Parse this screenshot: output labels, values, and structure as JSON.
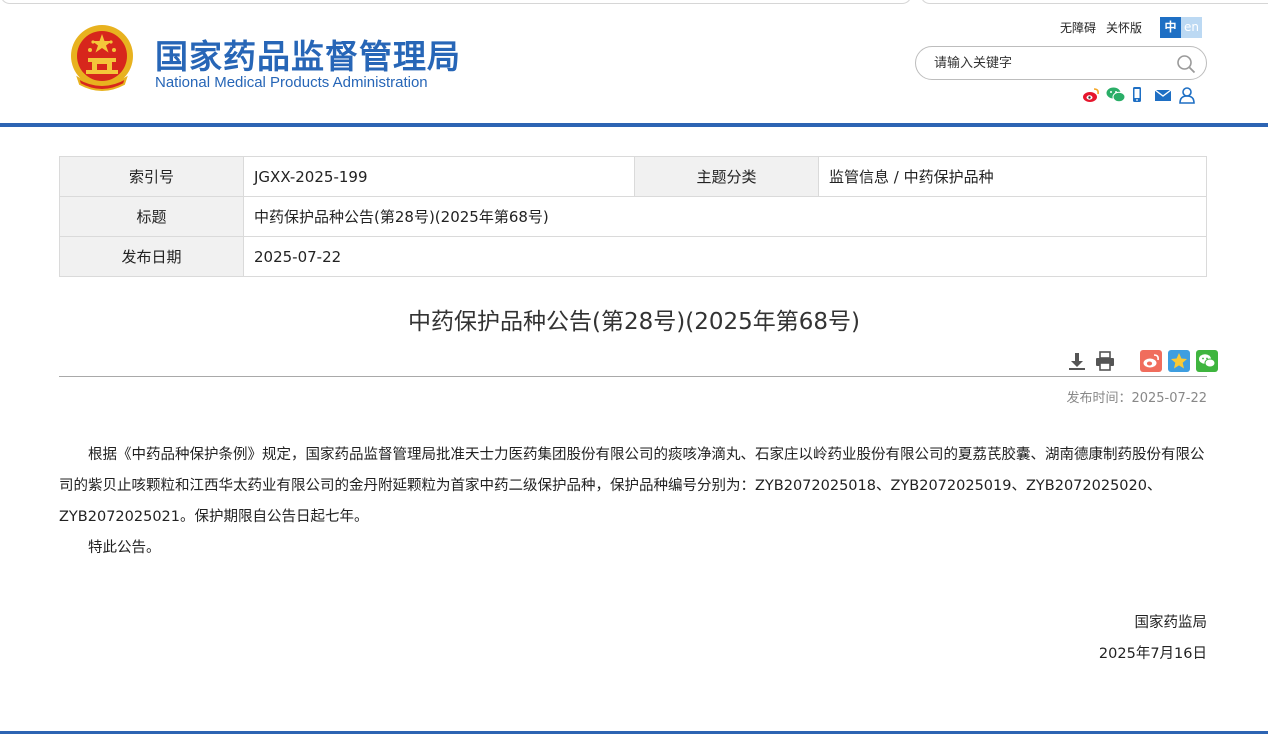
{
  "header": {
    "site_name_cn": "国家药品监督管理局",
    "site_name_en": "National Medical Products Administration",
    "accessibility_link": "无障碍",
    "elderly_link": "关怀版",
    "lang_zh": "中",
    "lang_en": "en",
    "search_placeholder": "请输入关键字"
  },
  "info_table": {
    "index_label": "索引号",
    "index_value": "JGXX-2025-199",
    "category_label": "主题分类",
    "category_value": "监管信息 / 中药保护品种",
    "title_label": "标题",
    "title_value": "中药保护品种公告(第28号)(2025年第68号)",
    "date_label": "发布日期",
    "date_value": "2025-07-22"
  },
  "article": {
    "title": "中药保护品种公告(第28号)(2025年第68号)",
    "publish_time": "发布时间：2025-07-22",
    "paragraph_1": "根据《中药品种保护条例》规定，国家药品监督管理局批准天士力医药集团股份有限公司的痰咳净滴丸、石家庄以岭药业股份有限公司的夏荔芪胶囊、湖南德康制药股份有限公司的紫贝止咳颗粒和江西华太药业有限公司的金丹附延颗粒为首家中药二级保护品种，保护品种编号分别为：ZYB2072025018、ZYB2072025019、ZYB2072025020、ZYB2072025021。保护期限自公告日起七年。",
    "paragraph_2": "特此公告。",
    "signer": "国家药监局",
    "sign_date": "2025年7月16日"
  },
  "colors": {
    "brand_blue": "#2766b7",
    "rule_blue": "#2d64b3"
  },
  "icons": [
    "national-emblem-icon",
    "search-icon",
    "weibo-icon",
    "wechat-icon",
    "mobile-icon",
    "mail-icon",
    "user-icon",
    "download-icon",
    "print-icon",
    "share-weibo-icon",
    "share-qzone-icon",
    "share-wechat-icon"
  ]
}
